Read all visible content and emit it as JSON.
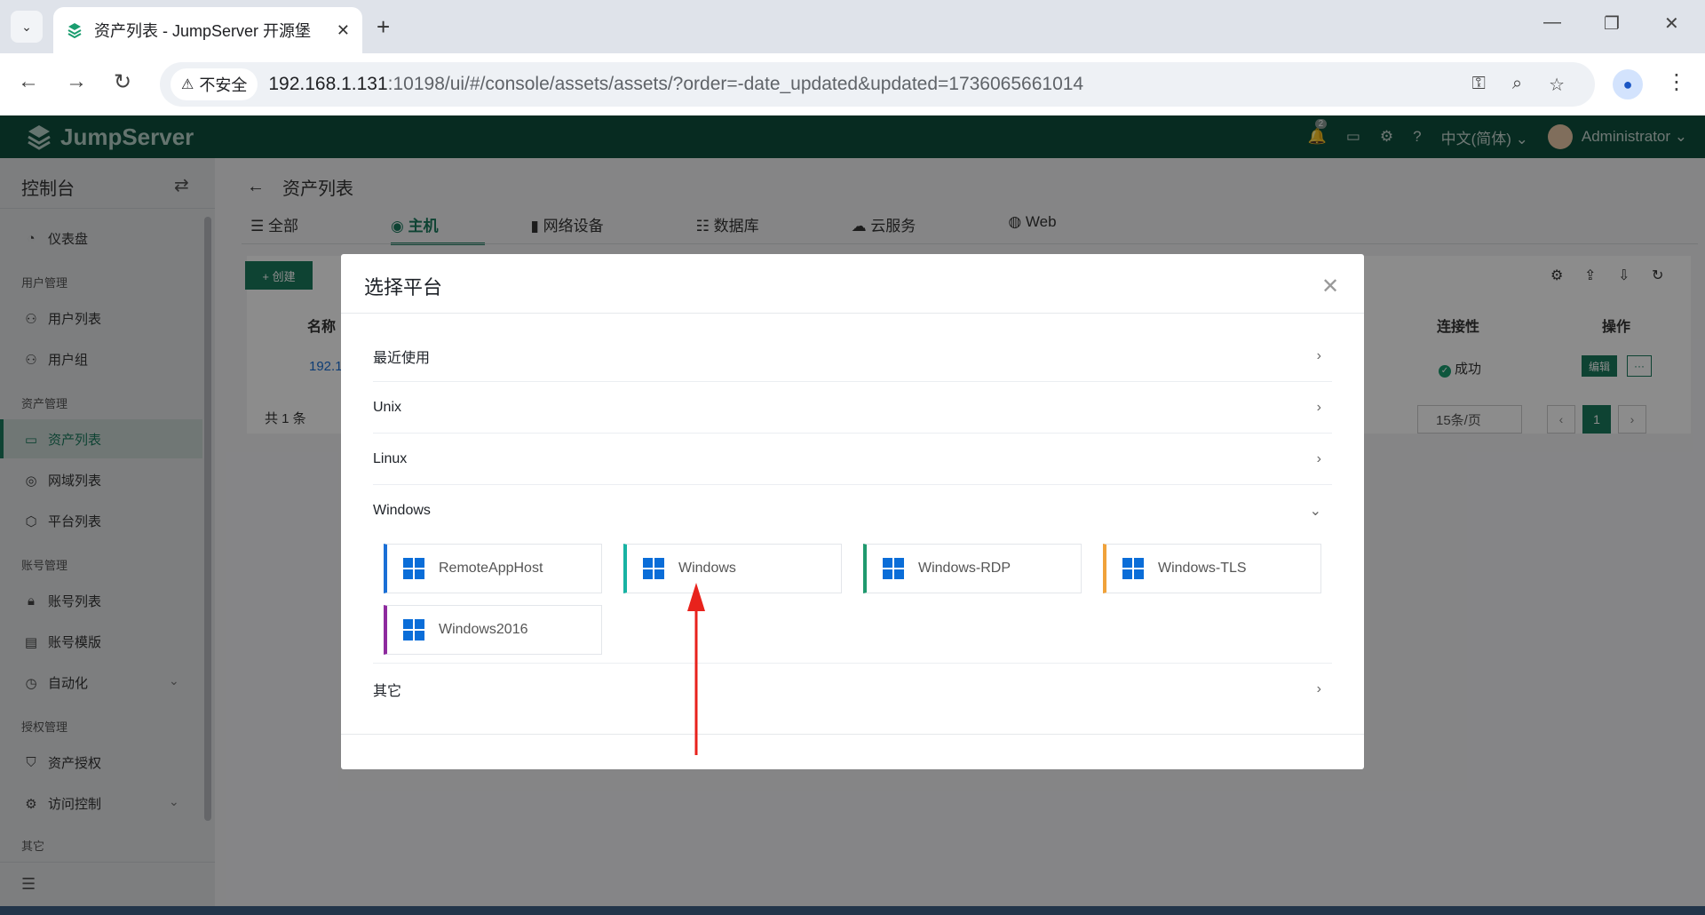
{
  "browser": {
    "tab_title": "资产列表 - JumpServer 开源堡",
    "security_label": "不安全",
    "url_host": "192.168.1.131",
    "url_path": ":10198/ui/#/console/assets/assets/?order=-date_updated&updated=1736065661014"
  },
  "header": {
    "logo": "JumpServer",
    "notification_count": "2",
    "language": "中文(简体)",
    "user": "Administrator"
  },
  "sidebar": {
    "title": "控制台",
    "dashboard": "仪表盘",
    "group_users": "用户管理",
    "user_list": "用户列表",
    "user_group": "用户组",
    "group_assets": "资产管理",
    "asset_list": "资产列表",
    "zone_list": "网域列表",
    "platform_list": "平台列表",
    "group_accounts": "账号管理",
    "account_list": "账号列表",
    "account_template": "账号模版",
    "automation": "自动化",
    "group_perms": "授权管理",
    "asset_perm": "资产授权",
    "access_control": "访问控制",
    "group_other": "其它"
  },
  "main": {
    "page_title": "资产列表",
    "tabs": [
      "全部",
      "主机",
      "网络设备",
      "数据库",
      "云服务",
      "Web"
    ],
    "create_label": "+ 创建",
    "col_name": "名称",
    "col_connectivity": "连接性",
    "col_actions": "操作",
    "row_name": "192.1",
    "row_status": "成功",
    "edit_label": "编辑",
    "more_label": "···",
    "total": "共 1 条",
    "page_size": "15条/页",
    "current_page": "1"
  },
  "modal": {
    "title": "选择平台",
    "sections": {
      "recent": "最近使用",
      "unix": "Unix",
      "linux": "Linux",
      "windows": "Windows",
      "other": "其它"
    },
    "windows_platforms": [
      {
        "name": "RemoteAppHost",
        "accent": "#1a6fd6"
      },
      {
        "name": "Windows",
        "accent": "#17b3a3"
      },
      {
        "name": "Windows-RDP",
        "accent": "#1f9a6e"
      },
      {
        "name": "Windows-TLS",
        "accent": "#f0a23a"
      },
      {
        "name": "Windows2016",
        "accent": "#8e2a9e"
      }
    ]
  }
}
